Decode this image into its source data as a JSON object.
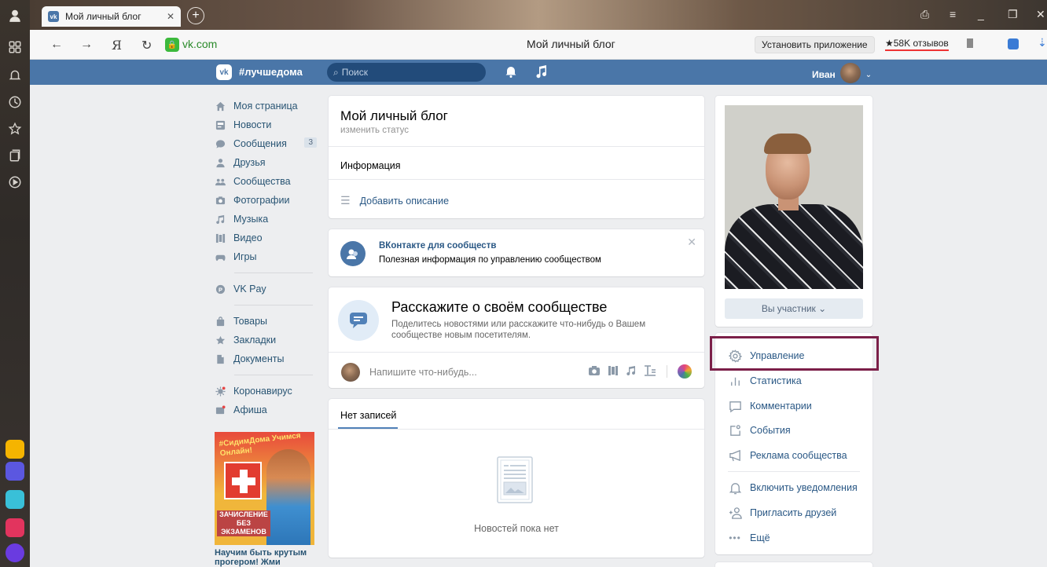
{
  "browser": {
    "tab_title": "Мой личный блог",
    "url": "vk.com",
    "page_title": "Мой личный блог",
    "install_app": "Установить приложение",
    "reviews": "★58K отзывов"
  },
  "vk_header": {
    "hashtag": "#лучшедома",
    "search_placeholder": "Поиск",
    "user_name": "Иван"
  },
  "left_menu": {
    "items": [
      {
        "label": "Моя страница"
      },
      {
        "label": "Новости"
      },
      {
        "label": "Сообщения",
        "badge": "3"
      },
      {
        "label": "Друзья"
      },
      {
        "label": "Сообщества"
      },
      {
        "label": "Фотографии"
      },
      {
        "label": "Музыка"
      },
      {
        "label": "Видео"
      },
      {
        "label": "Игры"
      }
    ],
    "vkpay": "VK Pay",
    "items2": [
      {
        "label": "Товары"
      },
      {
        "label": "Закладки"
      },
      {
        "label": "Документы"
      }
    ],
    "items3": [
      {
        "label": "Коронавирус"
      },
      {
        "label": "Афиша"
      }
    ],
    "promo": {
      "top_text": "#СидимДома Учимся Онлайн!",
      "bottom_text": "ЗАЧИСЛЕНИЕ БЕЗ ЭКЗАМЕНОВ",
      "caption": "Научим быть крутым прогером! Жми"
    }
  },
  "group": {
    "title": "Мой личный блог",
    "status": "изменить статус",
    "info_label": "Информация",
    "add_description": "Добавить описание"
  },
  "notice": {
    "title": "ВКонтакте для сообществ",
    "text": "Полезная информация по управлению сообществом"
  },
  "tell": {
    "heading": "Расскажите о своём сообществе",
    "text": "Поделитесь новостями или расскажите что-нибудь о Вашем сообществе новым посетителям.",
    "post_placeholder": "Напишите что-нибудь..."
  },
  "wall": {
    "tab": "Нет записей",
    "empty": "Новостей пока нет"
  },
  "right": {
    "member_button": "Вы участник",
    "actions": [
      {
        "label": "Управление",
        "icon": "gear-icon"
      },
      {
        "label": "Статистика",
        "icon": "stats-icon"
      },
      {
        "label": "Комментарии",
        "icon": "comment-icon"
      },
      {
        "label": "События",
        "icon": "events-icon"
      },
      {
        "label": "Реклама сообщества",
        "icon": "megaphone-icon"
      }
    ],
    "actions2": [
      {
        "label": "Включить уведомления",
        "icon": "bell-icon"
      },
      {
        "label": "Пригласить друзей",
        "icon": "invite-icon"
      },
      {
        "label": "Ещё",
        "icon": "more-icon"
      }
    ]
  },
  "colors": {
    "vk_blue": "#4a76a8",
    "link": "#2a5885",
    "highlight": "#7b1f48"
  }
}
